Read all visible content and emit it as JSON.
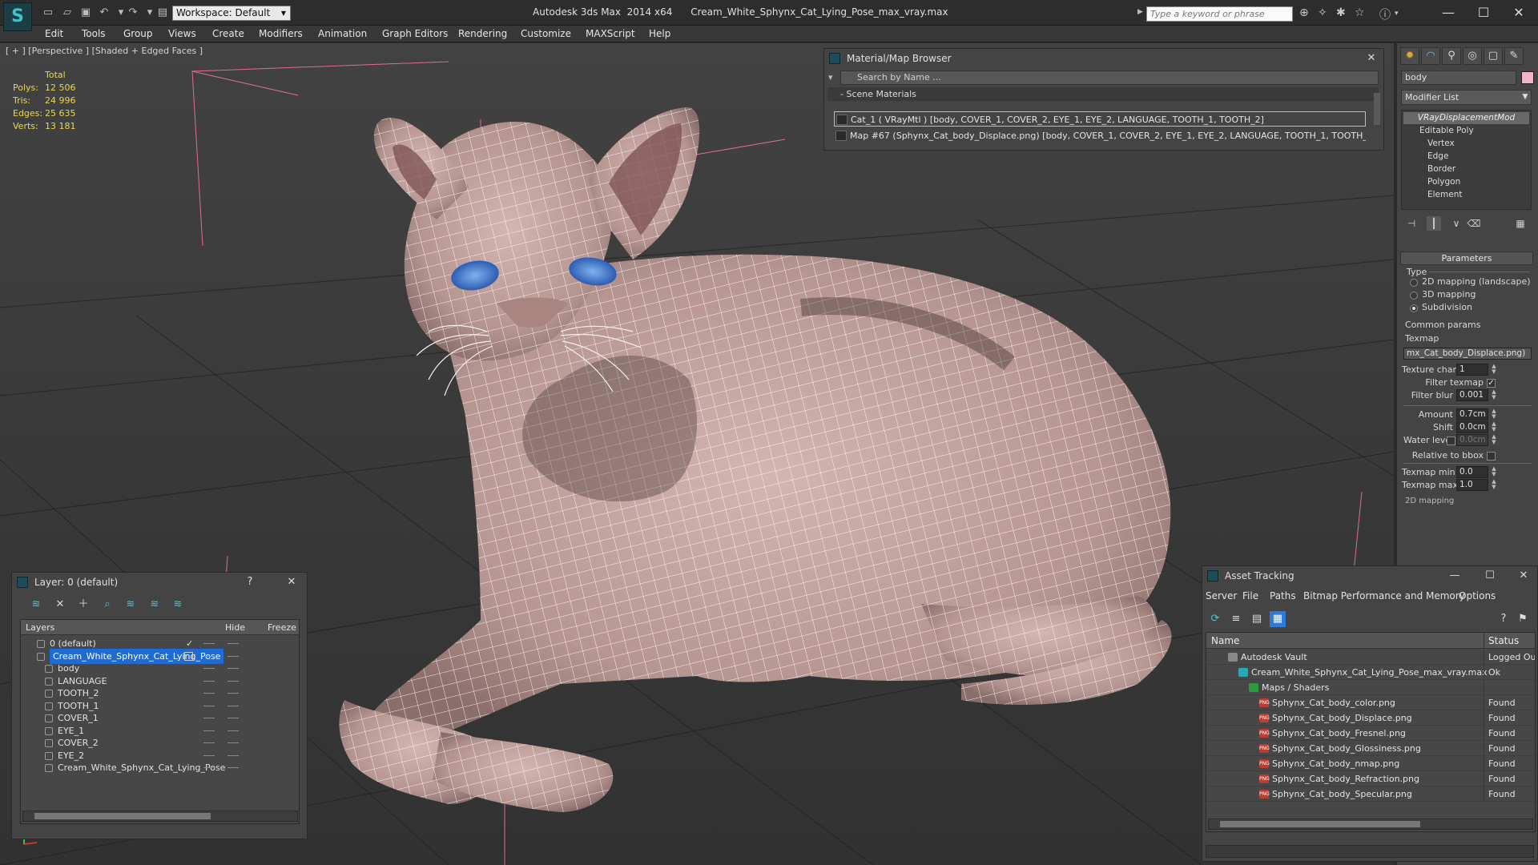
{
  "app": {
    "title": "Autodesk 3ds Max  2014 x64",
    "file": "Cream_White_Sphynx_Cat_Lying_Pose_max_vray.max",
    "workspace": "Workspace: Default",
    "search_placeholder": "Type a keyword or phrase",
    "logo_glyph": "S"
  },
  "menu": [
    "Edit",
    "Tools",
    "Group",
    "Views",
    "Create",
    "Modifiers",
    "Animation",
    "Graph Editors",
    "Rendering",
    "Customize",
    "MAXScript",
    "Help"
  ],
  "viewport": {
    "label": "[ + ] [Perspective ] [Shaded + Edged Faces ]",
    "stats": {
      "total_label": "Total",
      "rows": [
        {
          "key": "Polys:",
          "value": "12 506"
        },
        {
          "key": "Tris:",
          "value": "24 996"
        },
        {
          "key": "Edges:",
          "value": "25 635"
        },
        {
          "key": "Verts:",
          "value": "13 181"
        }
      ]
    },
    "colors": {
      "mesh": "#c9a7a4",
      "wire": "#ffffff",
      "grid": "#222222",
      "guide": "#e06b9a",
      "eye": "#3d72c8"
    }
  },
  "material_browser": {
    "title": "Material/Map Browser",
    "search_placeholder": "Search by Name ...",
    "section": "- Scene Materials",
    "rows": [
      "Cat_1  ( VRayMtl )  [body, COVER_1, COVER_2, EYE_1, EYE_2, LANGUAGE, TOOTH_1, TOOTH_2]",
      "Map #67 (Sphynx_Cat_body_Displace.png)  [body, COVER_1, COVER_2, EYE_1, EYE_2, LANGUAGE, TOOTH_1, TOOTH_2]"
    ]
  },
  "command_panel": {
    "object_name": "body",
    "swatch_color": "#f0b6c8",
    "modifier_list": "Modifier List",
    "stack": {
      "modifier": "VRayDisplacementMod",
      "base": "Editable Poly",
      "subobjects": [
        "Vertex",
        "Edge",
        "Border",
        "Polygon",
        "Element"
      ]
    },
    "parameters": {
      "rollout": "Parameters",
      "type_label": "Type",
      "type_options": [
        "2D mapping (landscape)",
        "3D mapping",
        "Subdivision"
      ],
      "type_selected": "Subdivision",
      "common_label": "Common params",
      "texmap_label": "Texmap",
      "texmap_value": "mx_Cat_body_Displace.png)",
      "texture_chan_label": "Texture chan",
      "texture_chan_value": "1",
      "filter_texmap_label": "Filter texmap",
      "filter_blur_label": "Filter blur",
      "filter_blur_value": "0.001",
      "amount_label": "Amount",
      "amount_value": "0.7cm",
      "shift_label": "Shift",
      "shift_value": "0.0cm",
      "water_level_label": "Water level",
      "water_level_value": "0.0cm",
      "relative_label": "Relative to bbox",
      "texmap_min_label": "Texmap min",
      "texmap_min_value": "0.0",
      "texmap_max_label": "Texmap max",
      "texmap_max_value": "1.0",
      "next_rollout": "2D mapping"
    }
  },
  "layer_window": {
    "title": "Layer: 0 (default)",
    "help": "?",
    "close": "✕",
    "columns": {
      "layers": "Layers",
      "hide": "Hide",
      "freeze": "Freeze"
    },
    "rows": [
      {
        "name": "0 (default)",
        "indent": 1,
        "type": "layer",
        "check": "✓"
      },
      {
        "name": "Cream_White_Sphynx_Cat_Lying_Pose",
        "indent": 1,
        "type": "layer",
        "selected": true
      },
      {
        "name": "body",
        "indent": 2,
        "type": "object"
      },
      {
        "name": "LANGUAGE",
        "indent": 2,
        "type": "object"
      },
      {
        "name": "TOOTH_2",
        "indent": 2,
        "type": "object"
      },
      {
        "name": "TOOTH_1",
        "indent": 2,
        "type": "object"
      },
      {
        "name": "COVER_1",
        "indent": 2,
        "type": "object"
      },
      {
        "name": "EYE_1",
        "indent": 2,
        "type": "object"
      },
      {
        "name": "COVER_2",
        "indent": 2,
        "type": "object"
      },
      {
        "name": "EYE_2",
        "indent": 2,
        "type": "object"
      },
      {
        "name": "Cream_White_Sphynx_Cat_Lying_Pose",
        "indent": 2,
        "type": "object"
      }
    ]
  },
  "asset_tracking": {
    "title": "Asset Tracking",
    "menu": [
      "Server",
      "File",
      "Paths",
      "Bitmap Performance and Memory",
      "Options"
    ],
    "columns": {
      "name": "Name",
      "status": "Status"
    },
    "rows": [
      {
        "name": "Autodesk Vault",
        "status": "Logged Ou",
        "level": 1,
        "kind": "vault"
      },
      {
        "name": "Cream_White_Sphynx_Cat_Lying_Pose_max_vray.max",
        "status": "Ok",
        "level": 2,
        "kind": "max"
      },
      {
        "name": "Maps / Shaders",
        "status": "",
        "level": 3,
        "kind": "folder"
      },
      {
        "name": "Sphynx_Cat_body_color.png",
        "status": "Found",
        "level": 4,
        "kind": "png"
      },
      {
        "name": "Sphynx_Cat_body_Displace.png",
        "status": "Found",
        "level": 4,
        "kind": "png"
      },
      {
        "name": "Sphynx_Cat_body_Fresnel.png",
        "status": "Found",
        "level": 4,
        "kind": "png"
      },
      {
        "name": "Sphynx_Cat_body_Glossiness.png",
        "status": "Found",
        "level": 4,
        "kind": "png"
      },
      {
        "name": "Sphynx_Cat_body_nmap.png",
        "status": "Found",
        "level": 4,
        "kind": "png"
      },
      {
        "name": "Sphynx_Cat_body_Refraction.png",
        "status": "Found",
        "level": 4,
        "kind": "png"
      },
      {
        "name": "Sphynx_Cat_body_Specular.png",
        "status": "Found",
        "level": 4,
        "kind": "png"
      }
    ]
  }
}
